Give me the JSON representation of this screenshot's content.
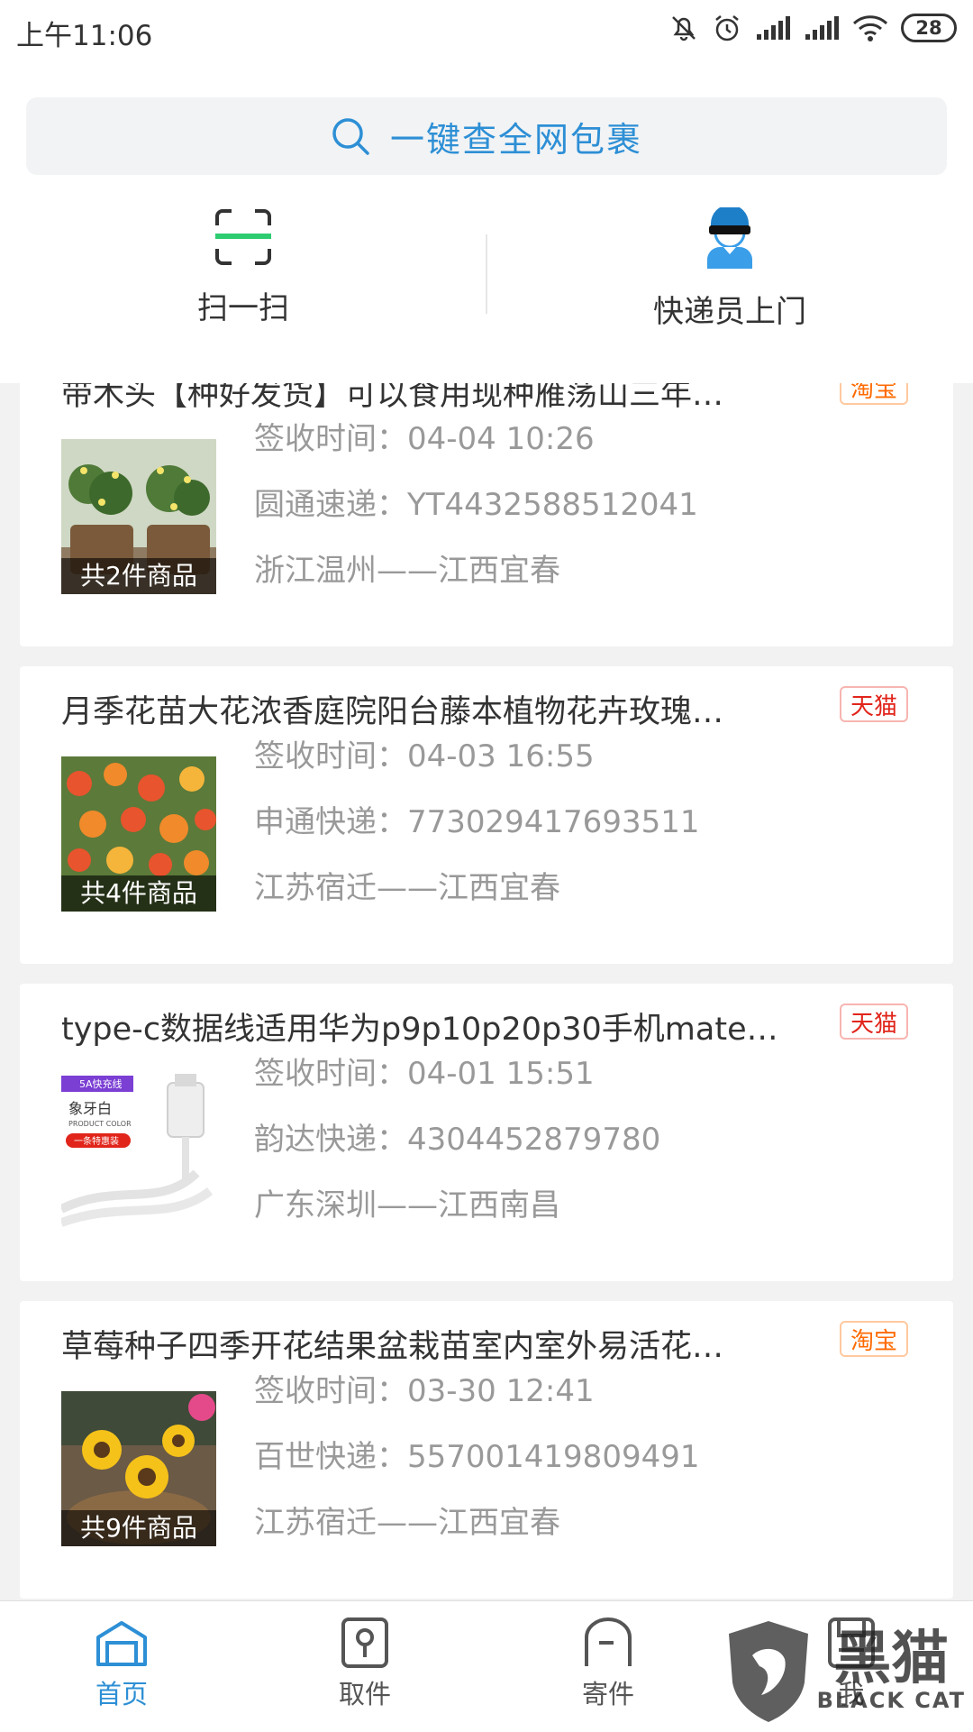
{
  "status_bar": {
    "time": "上午11:06",
    "battery": "28"
  },
  "search": {
    "placeholder": "一键查全网包裹"
  },
  "actions": {
    "scan_label": "扫一扫",
    "courier_label": "快递员上门"
  },
  "orders": [
    {
      "title": "带木头【种好发货】可以食用现种雁荡山三年…",
      "tag": "淘宝",
      "sign_time": "签收时间：04-04 10:26",
      "courier": "圆通速递：YT4432588512041",
      "route": "浙江温州——江西宜春",
      "item_count": "共2件商品"
    },
    {
      "title": "月季花苗大花浓香庭院阳台藤本植物花卉玫瑰…",
      "tag": "天猫",
      "sign_time": "签收时间：04-03 16:55",
      "courier": "申通快递：773029417693511",
      "route": "江苏宿迁——江西宜春",
      "item_count": "共4件商品"
    },
    {
      "title": "type-c数据线适用华为p9p10p20p30手机mate…",
      "tag": "天猫",
      "sign_time": "签收时间：04-01 15:51",
      "courier": "韵达快递：4304452879780",
      "route": "广东深圳——江西南昌",
      "item_count": "",
      "thumb_text": {
        "badge": "5A快充线",
        "color_cn": "象牙白",
        "color_en": "PRODUCT COLOR",
        "offer": "一条特惠装"
      }
    },
    {
      "title": "草莓种子四季开花结果盆栽苗室内室外易活花…",
      "tag": "淘宝",
      "sign_time": "签收时间：03-30 12:41",
      "courier": "百世快递：557001419809491",
      "route": "江苏宿迁——江西宜春",
      "item_count": "共9件商品"
    }
  ],
  "bottom_nav": [
    {
      "label": "首页",
      "icon": "home-icon",
      "active": true
    },
    {
      "label": "取件",
      "icon": "pickup-icon",
      "active": false
    },
    {
      "label": "寄件",
      "icon": "send-icon",
      "active": false
    },
    {
      "label": "我",
      "icon": "profile-icon",
      "active": false
    }
  ],
  "watermark": {
    "cn": "黑猫",
    "en": "BLACK CAT"
  },
  "colors": {
    "accent": "#2d8fd5",
    "taobao": "#ff6a00",
    "tmall": "#e1251b",
    "scan_line": "#2ecc71"
  }
}
